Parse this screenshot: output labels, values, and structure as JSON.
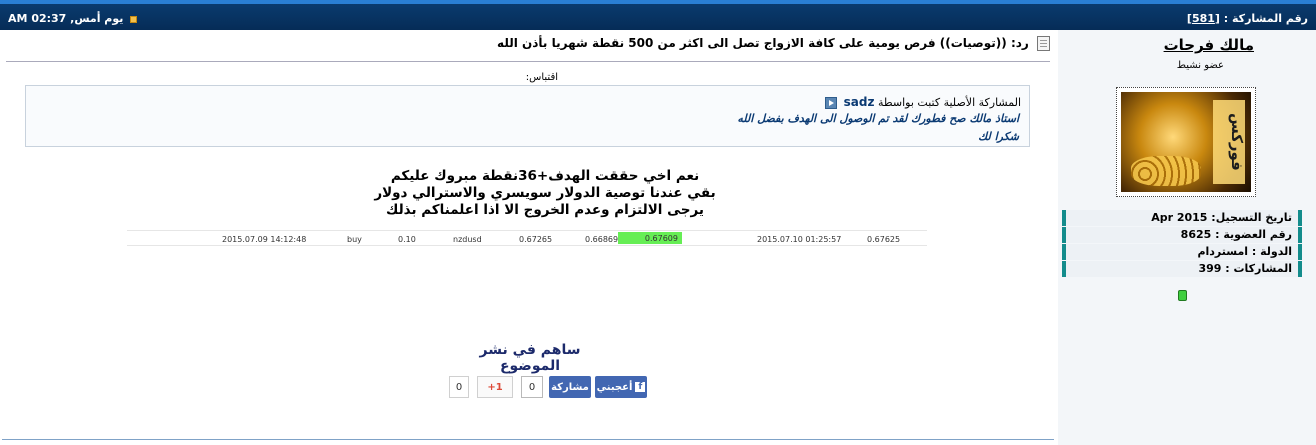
{
  "header": {
    "post_date": "يوم أمس, 02:37 AM",
    "post_number_label": "رقم المشاركة :",
    "post_number": "581"
  },
  "post": {
    "title": "رد: ((توصيات)) فرص يومية على كافة الازواج تصل الى اكثر من 500 نقطة شهريا بأذن الله",
    "quote_label": "اقتباس:",
    "quote": {
      "prefix": "المشاركة الأصلية كتبت بواسطة",
      "author": "sadz",
      "line1": "استاذ مالك صح فطورك لقد تم الوصول الى الهدف بفضل الله",
      "line2": "شكرا لك"
    },
    "message_lines": [
      "نعم اخي حققت الهدف+36نقطة مبروك عليكم",
      "بقي عندنا توصية الدولار سويسري والاسترالي دولار",
      "يرجى الالتزام وعدم الخروج الا اذا اعلمناكم بذلك"
    ],
    "trade": {
      "open_time": "2015.07.09 14:12:48",
      "type": "buy",
      "size": "0.10",
      "symbol": "nzdusd",
      "open_price": "0.67265",
      "stop_loss": "0.66869",
      "take_profit": "0.67609",
      "close_time": "2015.07.10 01:25:57",
      "close_price": "0.67625"
    },
    "share_heading": "ساهم في نشر الموضوع",
    "social": {
      "gplus_count": "0",
      "gplus_label": "+1",
      "share_count": "0",
      "share_label": "مشاركة",
      "like_label": "أعجبني"
    }
  },
  "user": {
    "name": "مالك فرحات",
    "title": "عضو نشيط",
    "avatar_text": "فوركس",
    "info": [
      "تاريخ التسجيل: Apr 2015",
      "رقم العضوية : 8625",
      "الدولة : امستردام",
      "المشاركات : 399"
    ]
  },
  "colors": {
    "header_bg": "#0a3b6e",
    "highlight": "#66ee55",
    "facebook": "#4267b2",
    "accent_border": "#138c8c"
  }
}
